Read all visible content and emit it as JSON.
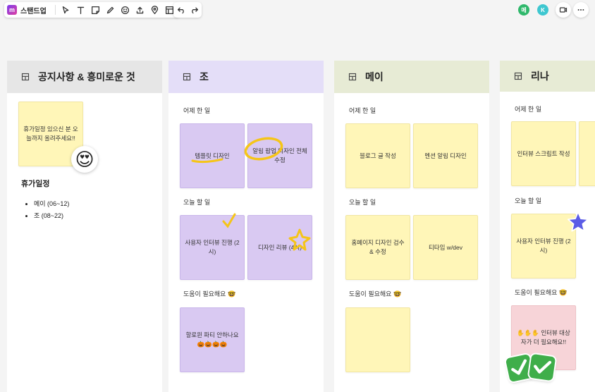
{
  "toolbar": {
    "logo_letter": "m",
    "board_name": "스탠드업",
    "tools": [
      "cursor-icon",
      "text-icon",
      "sticky-note-icon",
      "pen-icon",
      "emoji-icon",
      "upload-icon",
      "location-pin-icon",
      "frame-icon"
    ],
    "history": [
      "undo-icon",
      "redo-icon"
    ]
  },
  "collaborators": [
    {
      "initial": "메",
      "color": "#2fb86b"
    },
    {
      "initial": "K",
      "color": "#3ec7d0"
    }
  ],
  "right_actions": [
    "video-icon",
    "more-icon"
  ],
  "columns": [
    {
      "title": "공지사항 & 흥미로운 것",
      "header_color": "#e6e6e6",
      "notice_note": "휴가일정 있으신 분 오늘까지 올려주세요!!",
      "vacation_title": "휴가일정",
      "vacation_items": [
        "메이 (06~12)",
        "조 (08~22)"
      ]
    },
    {
      "title": "조",
      "header_color": "#e4def8",
      "sections": [
        {
          "label": "어제 한 일",
          "notes": [
            "템플릿 디자인",
            "알림 팝업 디자인 전체 수정"
          ]
        },
        {
          "label": "오늘 할 일",
          "notes": [
            "사용자 인터뷰 진행 (2시)",
            "디자인 리뷰 (4시)"
          ]
        },
        {
          "label": "도움이 필요해요 🤓",
          "notes": [
            "할로윈 파티 안하나요 🎃🎃🎃🎃"
          ]
        }
      ]
    },
    {
      "title": "메이",
      "header_color": "#e7ebd5",
      "sections": [
        {
          "label": "어제 한 일",
          "notes": [
            "블로그 글 작성",
            "멘션 알림 디자인"
          ]
        },
        {
          "label": "오늘 할 일",
          "notes": [
            "홈페이지 디자인 검수 & 수정",
            "티타임 w/dev"
          ]
        },
        {
          "label": "도움이 필요해요 🤓",
          "notes": [
            ""
          ]
        }
      ]
    },
    {
      "title": "리나",
      "header_color": "#e7ebd5",
      "sections": [
        {
          "label": "어제 한 일",
          "notes": [
            "인터뷰 스크립트 작성"
          ]
        },
        {
          "label": "오늘 할 일",
          "notes": [
            "사용자 인터뷰 진행 (2시)"
          ]
        },
        {
          "label": "도움이 필요해요 🤓",
          "notes": [
            "✋✋✋ 인터뷰 대상자가 더 필요해요!!"
          ]
        }
      ]
    }
  ],
  "stickers": {
    "heart_eyes": "😍",
    "star_color": "#5b5ce6",
    "check_color": "#3fae4a"
  }
}
